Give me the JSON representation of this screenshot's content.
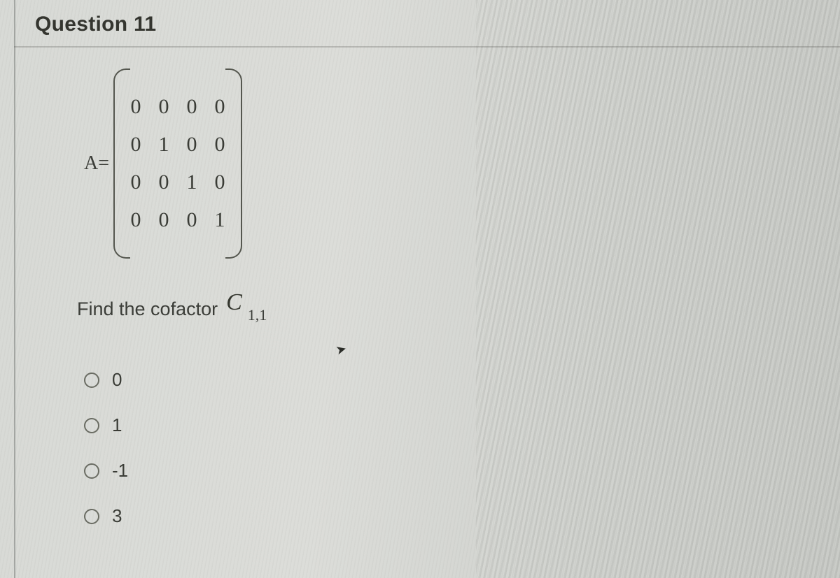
{
  "question": {
    "title": "Question 11",
    "matrix_label": "A=",
    "matrix": [
      [
        "0",
        "0",
        "0",
        "0"
      ],
      [
        "0",
        "1",
        "0",
        "0"
      ],
      [
        "0",
        "0",
        "1",
        "0"
      ],
      [
        "0",
        "0",
        "0",
        "1"
      ]
    ],
    "prompt_text": "Find the cofactor",
    "cofactor_symbol": "C",
    "cofactor_subscript": "1,1",
    "options": [
      {
        "label": "0"
      },
      {
        "label": "1"
      },
      {
        "label": "-1"
      },
      {
        "label": "3"
      }
    ]
  }
}
